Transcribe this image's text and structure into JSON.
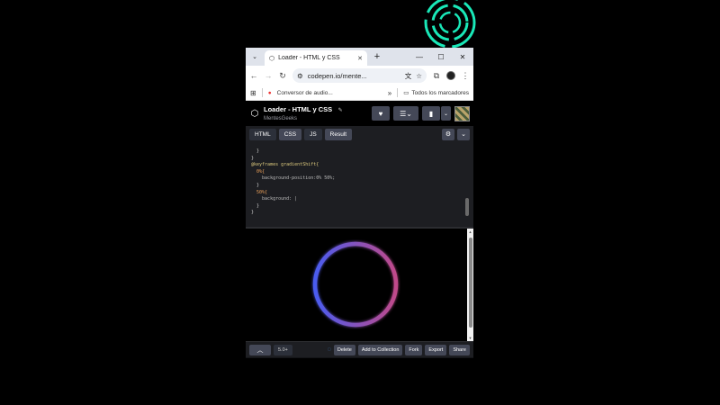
{
  "browser": {
    "tab_title": "Loader - HTML y CSS",
    "url": "codepen.io/mente...",
    "bookmark": "Conversor de audio...",
    "all_bookmarks": "Todos los marcadores"
  },
  "codepen": {
    "pen_title": "Loader - HTML y CSS",
    "user": "MentesGeeks"
  },
  "editor": {
    "tabs": [
      "HTML",
      "CSS",
      "JS",
      "Result"
    ],
    "active_tab": "CSS",
    "code_lines": [
      "  }",
      "}",
      "@keyframes gradientShift{",
      "  0%{",
      "    background-position:0% 50%;",
      "  }",
      "  50%{",
      "    background: |",
      "  }",
      "}"
    ]
  },
  "footer": {
    "version": "5.0+",
    "delete": "Delete",
    "add_collection": "Add to Collection",
    "fork": "Fork",
    "export": "Export",
    "share": "Share"
  },
  "colors": {
    "ring_start": "#4a5cf0",
    "ring_end": "#c04a8a",
    "neon": "#19e8b8"
  }
}
